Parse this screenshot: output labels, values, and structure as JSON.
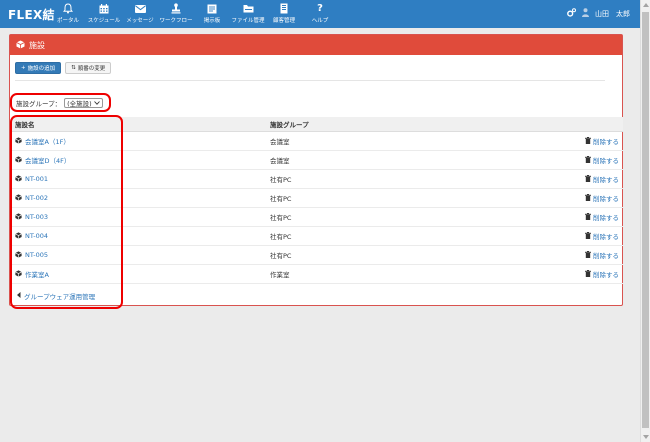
{
  "app": {
    "logo": "FLEX結"
  },
  "nav": [
    {
      "label": "ポータル",
      "icon": "bell-icon"
    },
    {
      "label": "スケジュール",
      "icon": "calendar-icon"
    },
    {
      "label": "メッセージ",
      "icon": "envelope-icon"
    },
    {
      "label": "ワークフロー",
      "icon": "stamp-icon"
    },
    {
      "label": "掲示板",
      "icon": "board-icon"
    },
    {
      "label": "ファイル管理",
      "icon": "folder-icon"
    },
    {
      "label": "顧客管理",
      "icon": "customer-icon"
    },
    {
      "label": "ヘルプ",
      "icon": "help-icon"
    }
  ],
  "user": {
    "name": "山田　太郎"
  },
  "panel": {
    "title": "施設"
  },
  "toolbar": {
    "add_label": "施設の追加",
    "order_label": "順番の変更"
  },
  "filter": {
    "label": "施設グループ：",
    "selected": "(全施設)"
  },
  "table": {
    "headers": [
      "施設名",
      "施設グループ"
    ],
    "delete_label": "削除する",
    "rows": [
      {
        "name": "会議室A（1F）",
        "group": "会議室"
      },
      {
        "name": "会議室D（4F）",
        "group": "会議室"
      },
      {
        "name": "NT-001",
        "group": "社有PC"
      },
      {
        "name": "NT-002",
        "group": "社有PC"
      },
      {
        "name": "NT-003",
        "group": "社有PC"
      },
      {
        "name": "NT-004",
        "group": "社有PC"
      },
      {
        "name": "NT-005",
        "group": "社有PC"
      },
      {
        "name": "作業室A",
        "group": "作業室"
      }
    ]
  },
  "back_link": "グループウェア運用管理",
  "colors": {
    "nav_bg": "#2f7ec2",
    "panel_head": "#e04b3b",
    "link": "#2a74b8",
    "highlight": "#e00000"
  }
}
